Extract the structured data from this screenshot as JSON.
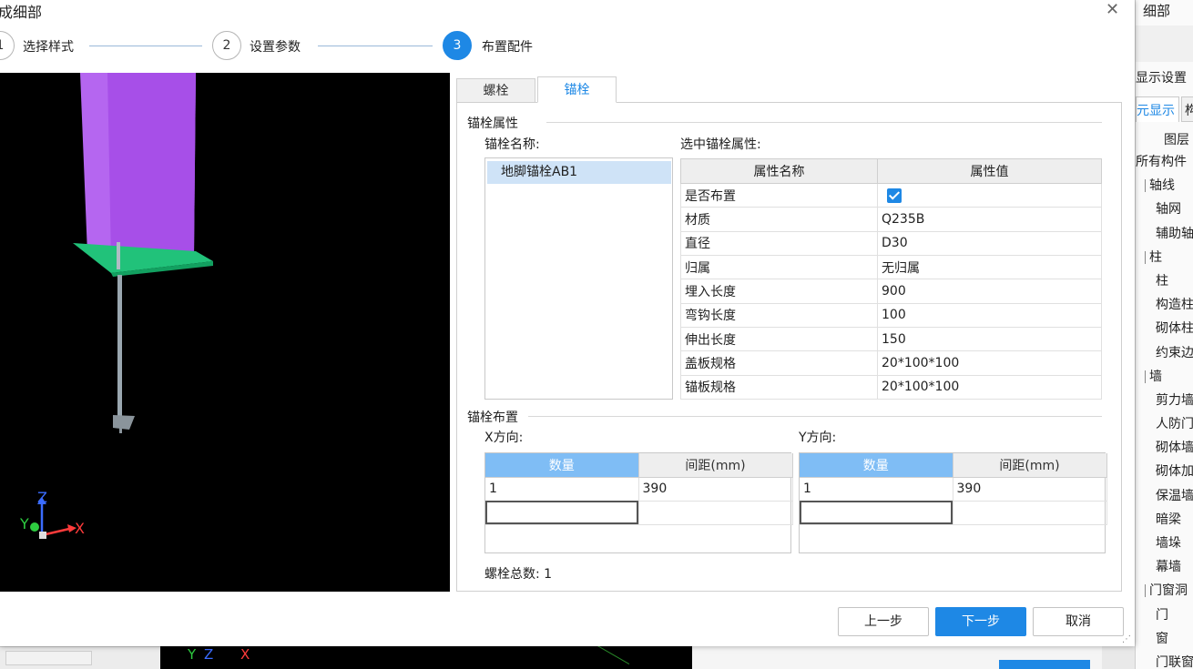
{
  "dialog": {
    "title": "成细部",
    "close_icon": "close-icon",
    "steps": [
      {
        "number": "1",
        "label": "选择样式"
      },
      {
        "number": "2",
        "label": "设置参数"
      },
      {
        "number": "3",
        "label": "布置配件"
      }
    ],
    "active_step": 3,
    "tabs": [
      "螺栓",
      "锚栓"
    ],
    "active_tab": "锚栓",
    "axis_labels": {
      "z": "Z",
      "y": "Y",
      "x": "X"
    },
    "anchor_props": {
      "group_title": "锚栓属性",
      "name_label": "锚栓名称:",
      "names": [
        "地脚锚栓AB1"
      ],
      "selected_label": "选中锚栓属性:",
      "table_headers": [
        "属性名称",
        "属性值"
      ],
      "rows": [
        {
          "name": "是否布置",
          "value": "",
          "checked": true
        },
        {
          "name": "材质",
          "value": "Q235B"
        },
        {
          "name": "直径",
          "value": "D30"
        },
        {
          "name": "归属",
          "value": "无归属"
        },
        {
          "name": "埋入长度",
          "value": "900"
        },
        {
          "name": "弯钩长度",
          "value": "100"
        },
        {
          "name": "伸出长度",
          "value": "150"
        },
        {
          "name": "盖板规格",
          "value": "20*100*100"
        },
        {
          "name": "锚板规格",
          "value": "20*100*100"
        }
      ]
    },
    "layout": {
      "group_title": "锚栓布置",
      "x_label": "X方向:",
      "y_label": "Y方向:",
      "x_headers": [
        "数量",
        "间距(mm)"
      ],
      "y_headers": [
        "数量",
        "间距(mm)"
      ],
      "x_rows": [
        [
          "1",
          "390"
        ]
      ],
      "y_rows": [
        [
          "1",
          "390"
        ]
      ],
      "total_label": "螺栓总数: 1"
    },
    "buttons": {
      "prev": "上一步",
      "next": "下一步",
      "cancel": "取消"
    }
  },
  "side_panel": {
    "title": "细部",
    "display_settings": "显示设置",
    "tab_active": "元显示",
    "tab_other": "构",
    "column_header": "图层",
    "items": [
      {
        "label": "所有构件",
        "level": 0
      },
      {
        "label": "轴线",
        "level": 1
      },
      {
        "label": "轴网",
        "level": 2
      },
      {
        "label": "辅助轴",
        "level": 2
      },
      {
        "label": "柱",
        "level": 1
      },
      {
        "label": "柱",
        "level": 2
      },
      {
        "label": "构造柱",
        "level": 2
      },
      {
        "label": "砌体柱",
        "level": 2
      },
      {
        "label": "约束边",
        "level": 2
      },
      {
        "label": "墙",
        "level": 1
      },
      {
        "label": "剪力墙",
        "level": 2
      },
      {
        "label": "人防门",
        "level": 2
      },
      {
        "label": "砌体墙",
        "level": 2
      },
      {
        "label": "砌体加",
        "level": 2
      },
      {
        "label": "保温墙",
        "level": 2
      },
      {
        "label": "暗梁",
        "level": 2
      },
      {
        "label": "墙垛",
        "level": 2
      },
      {
        "label": "幕墙",
        "level": 2
      },
      {
        "label": "门窗洞",
        "level": 1
      },
      {
        "label": "门",
        "level": 2
      },
      {
        "label": "窗",
        "level": 2
      },
      {
        "label": "门联窗",
        "level": 2
      }
    ]
  },
  "background": {
    "viewport_axis": "Y Z X"
  },
  "colors": {
    "accent": "#1e88e5",
    "column": "#b566f0",
    "base_plate": "#21c27a",
    "header_selected": "#7fbdf5"
  }
}
